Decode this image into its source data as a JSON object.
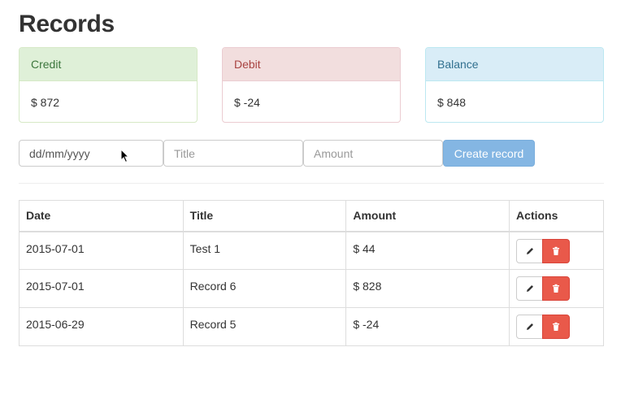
{
  "page": {
    "title": "Records"
  },
  "summary": {
    "credit": {
      "label": "Credit",
      "value": "$ 872"
    },
    "debit": {
      "label": "Debit",
      "value": "$ -24"
    },
    "balance": {
      "label": "Balance",
      "value": "$ 848"
    }
  },
  "form": {
    "date_placeholder": "dd/mm/yyyy",
    "title_placeholder": "Title",
    "amount_placeholder": "Amount",
    "submit_label": "Create record"
  },
  "table": {
    "headers": {
      "date": "Date",
      "title": "Title",
      "amount": "Amount",
      "actions": "Actions"
    },
    "rows": [
      {
        "date": "2015-07-01",
        "title": "Test 1",
        "amount": "$ 44"
      },
      {
        "date": "2015-07-01",
        "title": "Record 6",
        "amount": "$ 828"
      },
      {
        "date": "2015-06-29",
        "title": "Record 5",
        "amount": "$ -24"
      }
    ]
  },
  "icons": {
    "edit": "pencil-icon",
    "delete": "trash-icon"
  },
  "colors": {
    "credit_heading": "#dff0d8",
    "debit_heading": "#f2dede",
    "balance_heading": "#d9edf7",
    "primary_button": "#84b6e3",
    "danger_button": "#e9594a"
  }
}
